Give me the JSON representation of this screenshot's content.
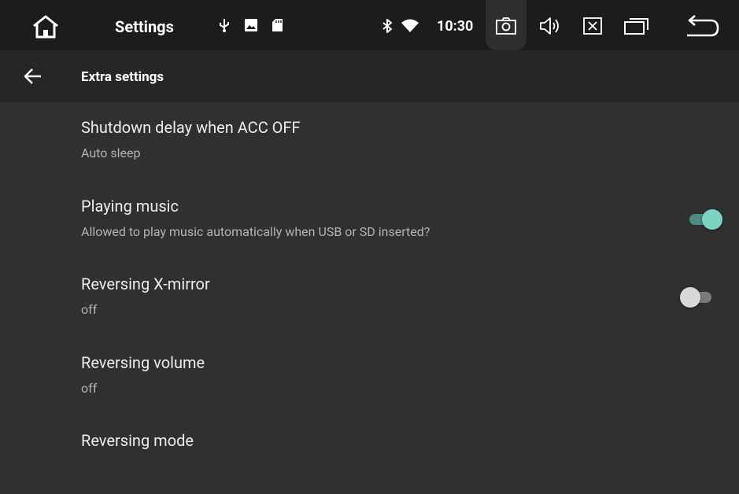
{
  "status_bar": {
    "app_title": "Settings",
    "time": "10:30",
    "icons": [
      "home-icon",
      "usb-icon",
      "image-icon",
      "sd-card-icon",
      "bluetooth-icon",
      "wifi-icon",
      "screenshot-icon",
      "volume-icon",
      "close-app-icon",
      "recent-apps-icon",
      "back-icon"
    ]
  },
  "toolbar": {
    "title": "Extra settings",
    "back_icon": "arrow-left-icon"
  },
  "settings": [
    {
      "title": "Shutdown delay when ACC OFF",
      "subtitle": "Auto sleep"
    },
    {
      "title": "Playing music",
      "subtitle": "Allowed to play music automatically when USB or SD inserted?",
      "toggle": true
    },
    {
      "title": "Reversing X-mirror",
      "subtitle": "off",
      "toggle": false
    },
    {
      "title": "Reversing volume",
      "subtitle": "off"
    },
    {
      "title": "Reversing mode",
      "subtitle": ""
    }
  ],
  "colors": {
    "status_bar_bg": "#1c1c1c",
    "toolbar_bg": "#262626",
    "list_bg": "#303030",
    "toggle_on_thumb": "#7fd3c3",
    "toggle_on_track": "#4d8c84",
    "toggle_off_thumb": "#d8d8d8",
    "toggle_off_track": "#7a7a7a"
  }
}
